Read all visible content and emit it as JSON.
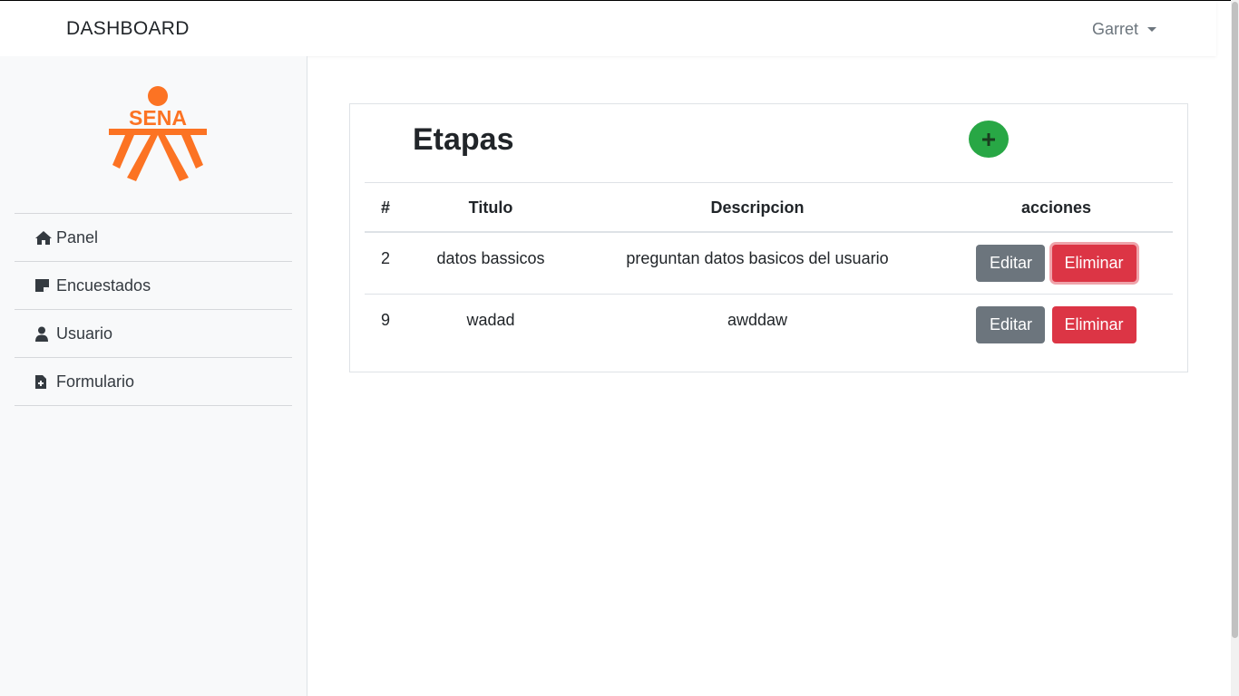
{
  "navbar": {
    "brand": "DASHBOARD",
    "user": "Garret"
  },
  "sidebar": {
    "logo_text": "SENA",
    "items": [
      {
        "label": "Panel",
        "icon": "home-icon"
      },
      {
        "label": "Encuestados",
        "icon": "sticky-note-icon"
      },
      {
        "label": "Usuario",
        "icon": "user-icon"
      },
      {
        "label": "Formulario",
        "icon": "file-medical-icon"
      }
    ]
  },
  "main": {
    "title": "Etapas",
    "add_icon": "plus-icon",
    "table": {
      "headers": [
        "#",
        "Titulo",
        "Descripcion",
        "acciones"
      ],
      "rows": [
        {
          "id": "2",
          "titulo": "datos bassicos",
          "descripcion": "preguntan datos basicos del usuario",
          "edit": "Editar",
          "delete": "Eliminar"
        },
        {
          "id": "9",
          "titulo": "wadad",
          "descripcion": "awddaw",
          "edit": "Editar",
          "delete": "Eliminar"
        }
      ]
    }
  },
  "colors": {
    "brand_orange": "#fc7323",
    "success": "#28a745",
    "secondary": "#6c757d",
    "danger": "#dc3545"
  }
}
